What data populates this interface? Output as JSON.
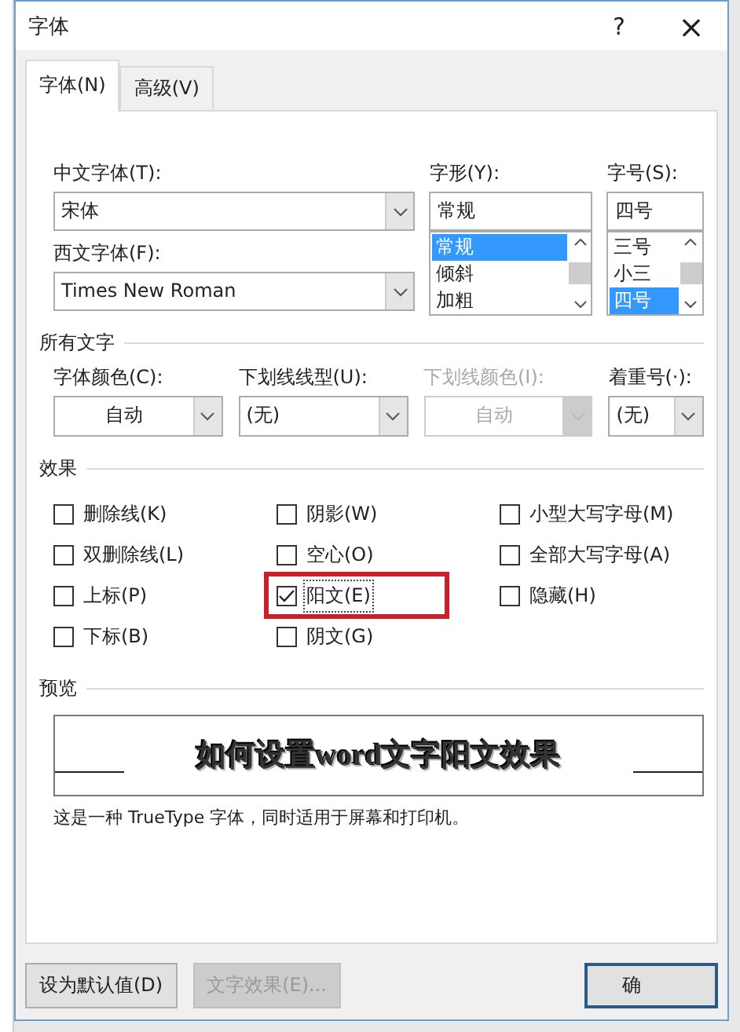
{
  "window": {
    "title": "字体",
    "help": "?",
    "close": "×"
  },
  "tabs": [
    {
      "label": "字体(N)",
      "selected": true
    },
    {
      "label": "高级(V)",
      "selected": false
    }
  ],
  "chinese_font": {
    "label": "中文字体(T):",
    "value": "宋体"
  },
  "western_font": {
    "label": "西文字体(F):",
    "value": "Times New Roman"
  },
  "style": {
    "label": "字形(Y):",
    "value": "常规",
    "options": [
      {
        "label": "常规",
        "selected": true
      },
      {
        "label": "倾斜",
        "selected": false
      },
      {
        "label": "加粗",
        "selected": false
      }
    ]
  },
  "size": {
    "label": "字号(S):",
    "value": "四号",
    "options": [
      {
        "label": "三号",
        "selected": false
      },
      {
        "label": "小三",
        "selected": false
      },
      {
        "label": "四号",
        "selected": true
      }
    ]
  },
  "all_text": {
    "title": "所有文字",
    "fields": [
      {
        "label": "字体颜色(C):",
        "value": "自动",
        "disabled": false,
        "kind": "color"
      },
      {
        "label": "下划线线型(U):",
        "value": "(无)",
        "disabled": false,
        "kind": "style"
      },
      {
        "label": "下划线颜色(I):",
        "value": "自动",
        "disabled": true,
        "kind": "color"
      },
      {
        "label": "着重号(·):",
        "value": "(无)",
        "disabled": false,
        "kind": "style"
      }
    ]
  },
  "effects": {
    "title": "效果",
    "items": [
      {
        "label": "删除线(K)",
        "checked": false,
        "highlighted": false
      },
      {
        "label": "阴影(W)",
        "checked": false,
        "highlighted": false
      },
      {
        "label": "小型大写字母(M)",
        "checked": false,
        "highlighted": false
      },
      {
        "label": "双删除线(L)",
        "checked": false,
        "highlighted": false
      },
      {
        "label": "空心(O)",
        "checked": false,
        "highlighted": false
      },
      {
        "label": "全部大写字母(A)",
        "checked": false,
        "highlighted": false
      },
      {
        "label": "上标(P)",
        "checked": false,
        "highlighted": false
      },
      {
        "label": "阳文(E)",
        "checked": true,
        "highlighted": true
      },
      {
        "label": "隐藏(H)",
        "checked": false,
        "highlighted": false
      },
      {
        "label": "下标(B)",
        "checked": false,
        "highlighted": false
      },
      {
        "label": "阴文(G)",
        "checked": false,
        "highlighted": false
      }
    ]
  },
  "preview": {
    "title": "预览",
    "sample": "如何设置word文字阳文效果",
    "note": "这是一种 TrueType 字体，同时适用于屏幕和打印机。"
  },
  "buttons": [
    {
      "label": "设为默认值(D)",
      "disabled": false,
      "kind": "plain"
    },
    {
      "label": "文字效果(E)...",
      "disabled": true,
      "kind": "plain"
    },
    {
      "label": "确",
      "disabled": false,
      "kind": "default"
    }
  ]
}
